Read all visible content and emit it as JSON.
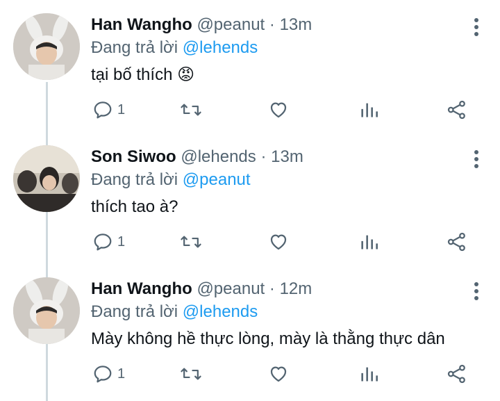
{
  "tweets": [
    {
      "name": "Han Wangho",
      "handle": "@peanut",
      "separator": "·",
      "time": "13m",
      "reply_prefix": "Đang trả lời",
      "reply_to": "@lehends",
      "text": "tại bố thích",
      "emoji": "😡",
      "reply_count": "1",
      "avatar": "bunny-ear-avatar"
    },
    {
      "name": "Son Siwoo",
      "handle": "@lehends",
      "separator": "·",
      "time": "13m",
      "reply_prefix": "Đang trả lời",
      "reply_to": "@peanut",
      "text": "thích tao à?",
      "emoji": "",
      "reply_count": "1",
      "avatar": "group-photo-avatar"
    },
    {
      "name": "Han Wangho",
      "handle": "@peanut",
      "separator": "·",
      "time": "12m",
      "reply_prefix": "Đang trả lời",
      "reply_to": "@lehends",
      "text": "Mày không hề thực lòng, mày là thằng thực dân",
      "emoji": "",
      "reply_count": "1",
      "avatar": "bunny-ear-avatar"
    }
  ],
  "colors": {
    "text": "#0f1419",
    "secondary": "#536471",
    "mention": "#1d9bf0",
    "thread_line": "#cfd9de"
  }
}
